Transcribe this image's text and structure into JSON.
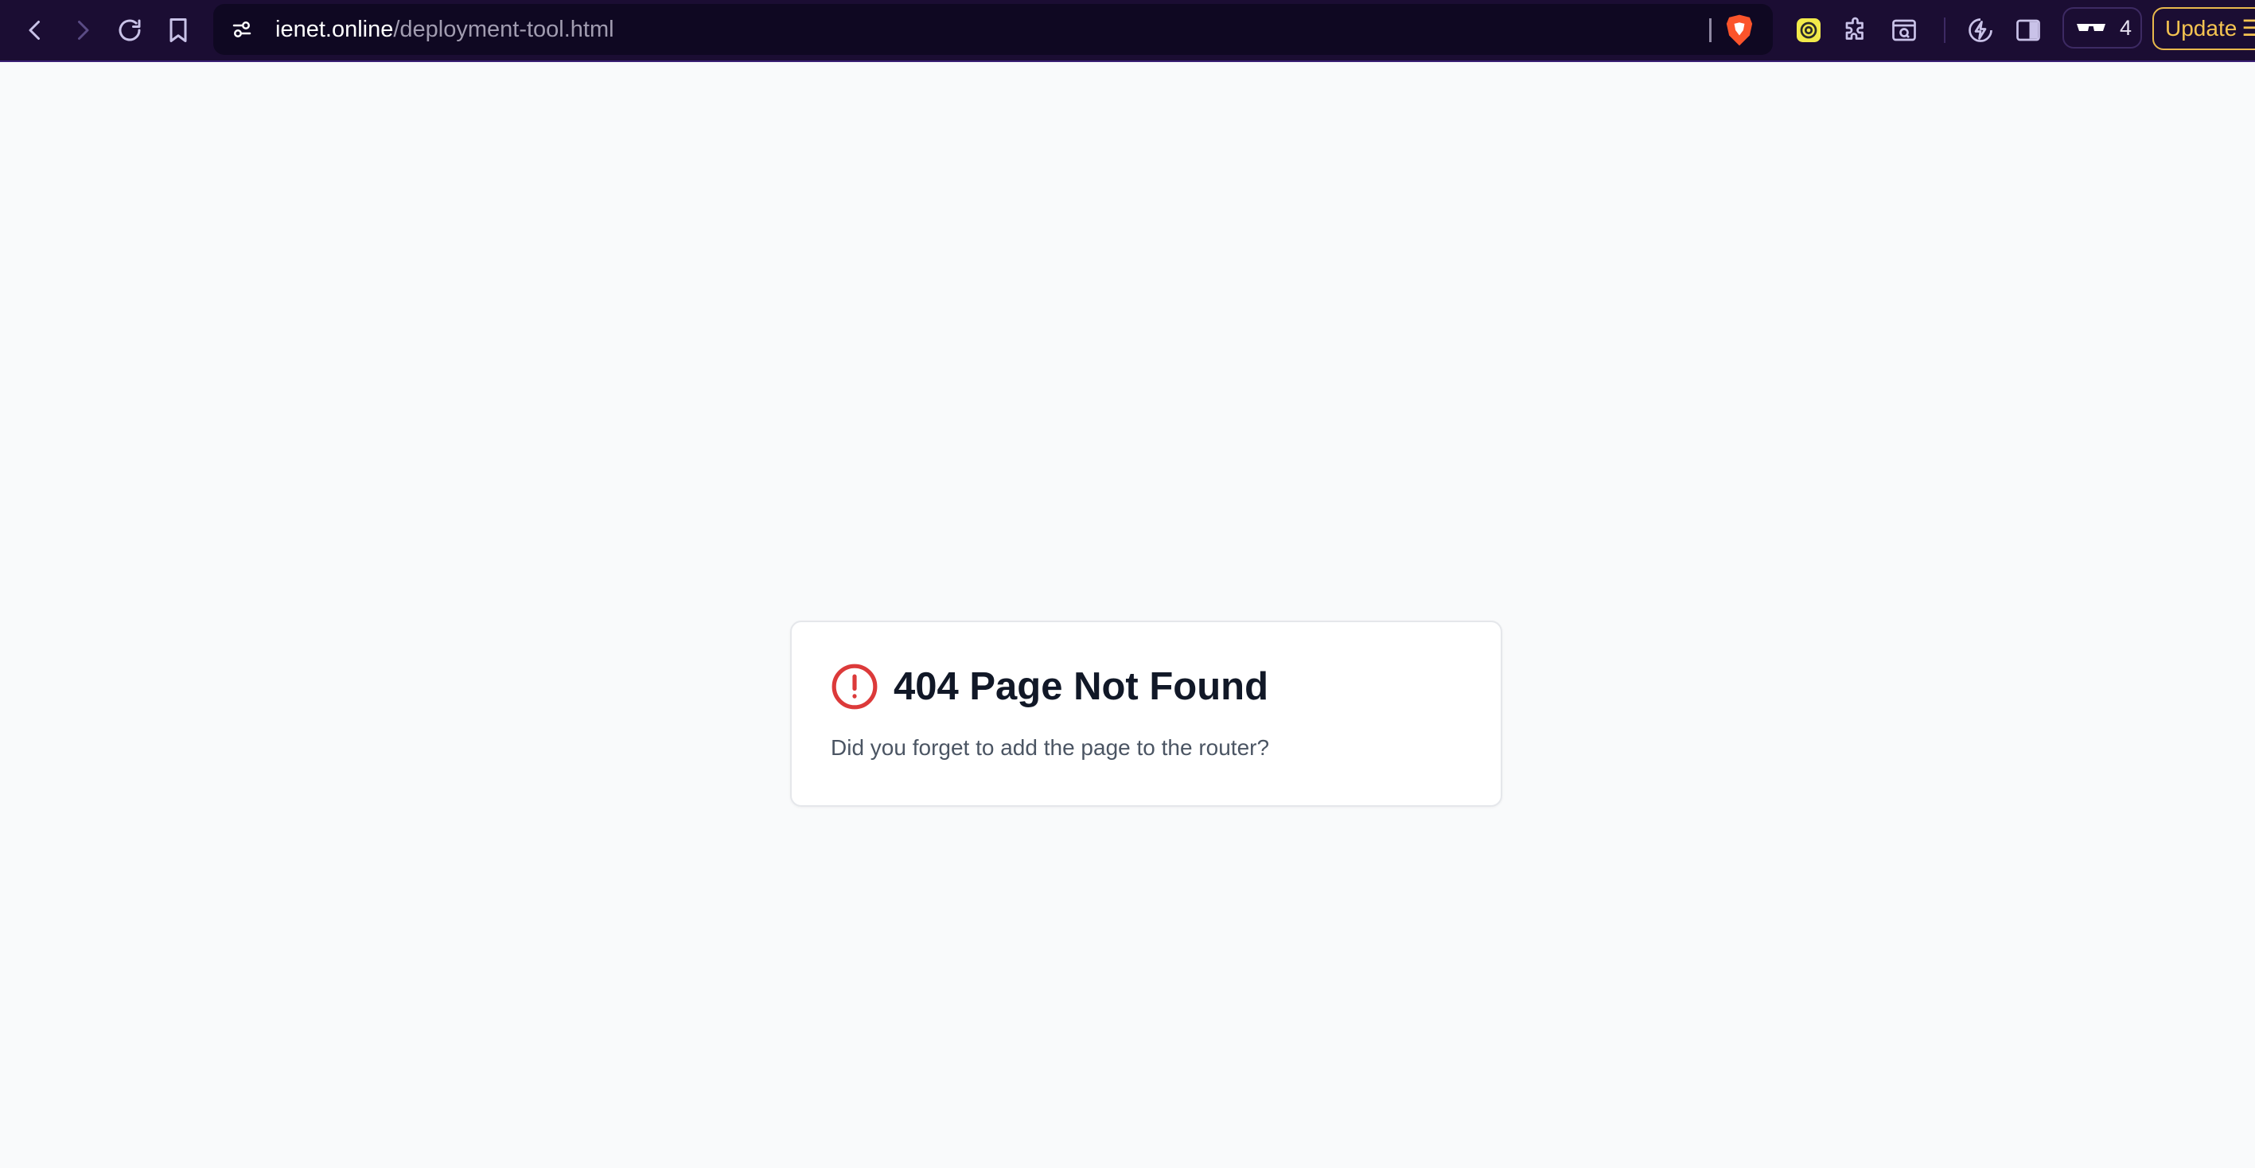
{
  "browser": {
    "url_host": "ienet.online",
    "url_path": "/deployment-tool.html",
    "tab_count": "4",
    "update_label": "Update",
    "update_menu_glyph": "☰",
    "icons": {
      "back": "chevron-left-icon",
      "forward": "chevron-right-icon",
      "reload": "reload-icon",
      "bookmark": "bookmark-icon",
      "site_info": "tune-icon",
      "shield": "brave-shield-icon",
      "extension_1": "yellow-extension-icon",
      "extensions": "puzzle-icon",
      "extension_2": "page-search-icon",
      "leo": "leo-icon",
      "sidebar": "sidebar-icon",
      "private": "glasses-icon"
    },
    "colors": {
      "toolbar_bg": "#1b0d33",
      "omnibox_bg": "#0f0822",
      "icon": "#b8aee0",
      "accent_update": "#f5c451"
    }
  },
  "page": {
    "background": "#f9fafb",
    "error_card": {
      "title": "404 Page Not Found",
      "message": "Did you forget to add the page to the router?",
      "icon": "alert-circle-icon",
      "icon_color": "#dc3a3a"
    }
  }
}
